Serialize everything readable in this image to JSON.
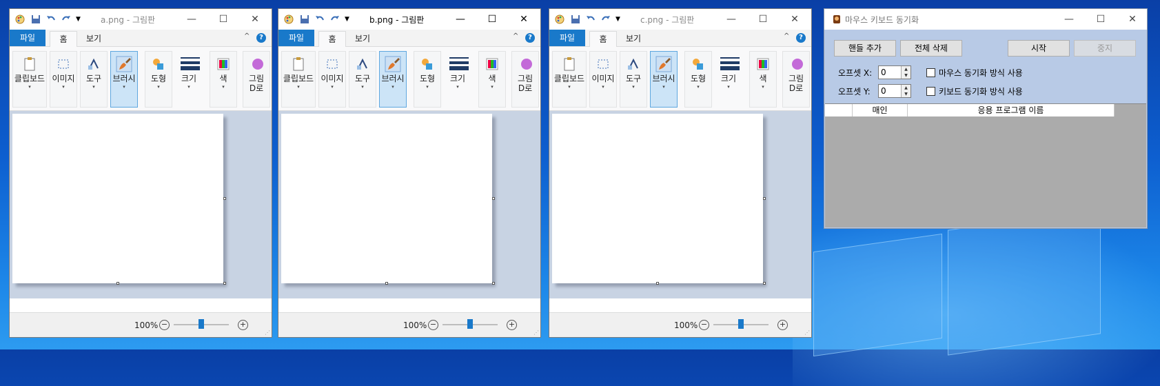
{
  "colors": {
    "desktop": "#0d5fd0",
    "file_tab": "#1979ca",
    "canvas_bg": "#c8d3e3",
    "selected_group": "#cce4f7"
  },
  "paint_windows": [
    {
      "title": "a.png - 그림판",
      "active": false
    },
    {
      "title": "b.png - 그림판",
      "active": true
    },
    {
      "title": "c.png - 그림판",
      "active": false
    }
  ],
  "paint": {
    "tabs": {
      "file": "파일",
      "home": "홈",
      "view": "보기"
    },
    "help": "?",
    "collapse": "^",
    "groups": {
      "clipboard": "클립보드",
      "image": "이미지",
      "tools": "도구",
      "brush": "브러시",
      "shapes": "도형",
      "size": "크기",
      "color": "색",
      "paint3d_1": "그림",
      "paint3d_2": "D로"
    },
    "dropdown": "▾",
    "zoom": "100%",
    "zoom_fraction": 0.5,
    "zoom_minus": "−",
    "zoom_plus": "+"
  },
  "caption": {
    "minimize": "—",
    "maximize": "☐",
    "close": "✕"
  },
  "sync_app": {
    "title": "마우스 키보드 동기화",
    "buttons": {
      "add_handle": "핸들 추가",
      "delete_all": "전체 삭제",
      "start": "시작",
      "stop": "중지"
    },
    "offset_x_label": "오프셋 X:",
    "offset_y_label": "오프셋 Y:",
    "offset_x": "0",
    "offset_y": "0",
    "mouse_sync": "마우스 동기화 방식 사용",
    "keyboard_sync": "키보드 동기화 방식 사용",
    "columns": [
      "",
      "매인",
      "응용 프로그램 이름"
    ]
  }
}
